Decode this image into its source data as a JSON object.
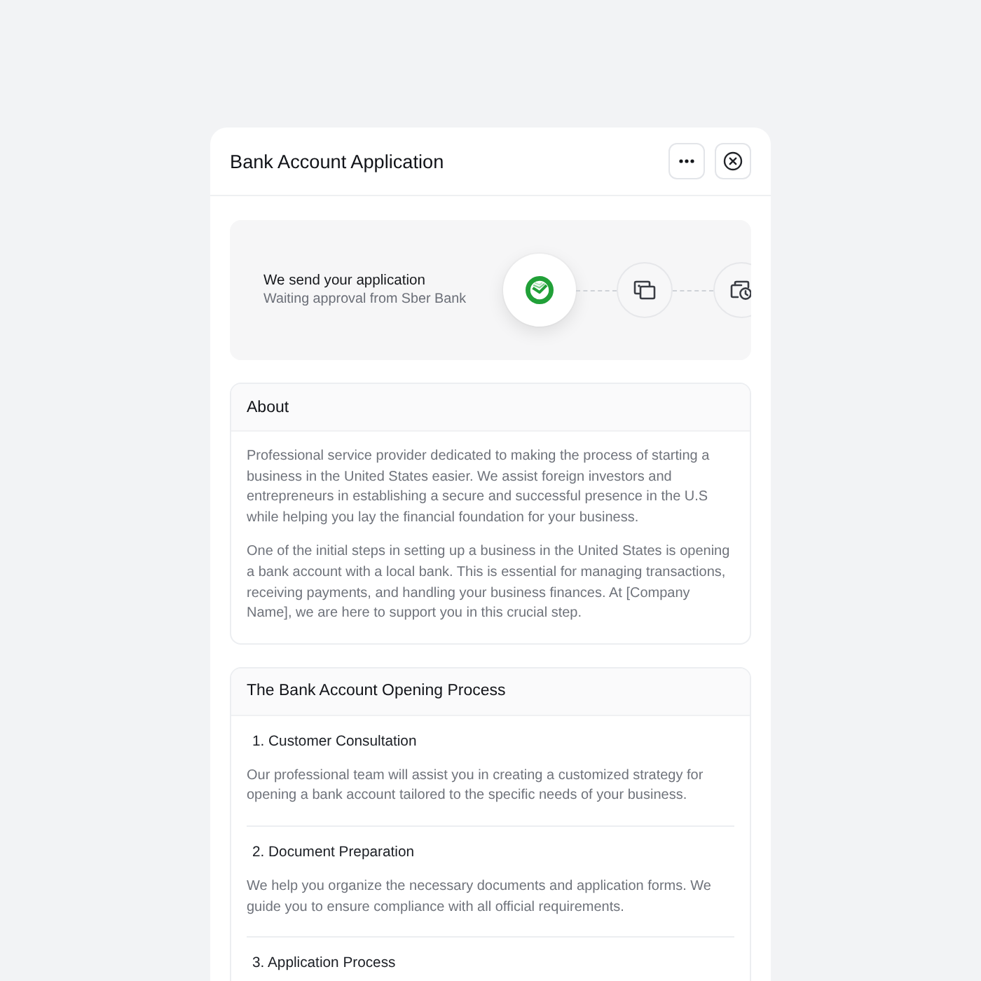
{
  "window": {
    "title": "Bank Account Application"
  },
  "status": {
    "title": "We send your application",
    "subtitle": "Waiting approval from Sber Bank",
    "steps": [
      {
        "active": true
      },
      {
        "active": false
      },
      {
        "active": false
      }
    ]
  },
  "about": {
    "title": "About",
    "paragraphs": [
      "Professional service provider dedicated to making the process of starting a business in the United States easier. We assist foreign investors and entrepreneurs in establishing a secure and successful presence in the U.S while helping you lay the financial foundation for your business.",
      "One of the initial steps in setting up a business in the United States is opening a bank account with a local bank. This is essential for managing transactions, receiving payments, and handling your business finances. At [Company Name], we are here to support you in this crucial step."
    ]
  },
  "process": {
    "title": "The Bank Account Opening Process",
    "steps": [
      {
        "title": "1. Customer Consultation",
        "description": "Our professional team will assist you in creating a customized strategy for opening a bank account tailored to the specific needs of your business."
      },
      {
        "title": "2. Document Preparation",
        "description": "We help you organize the necessary documents and application forms. We guide you to ensure compliance with all official requirements."
      },
      {
        "title": "3. Application Process"
      }
    ]
  }
}
